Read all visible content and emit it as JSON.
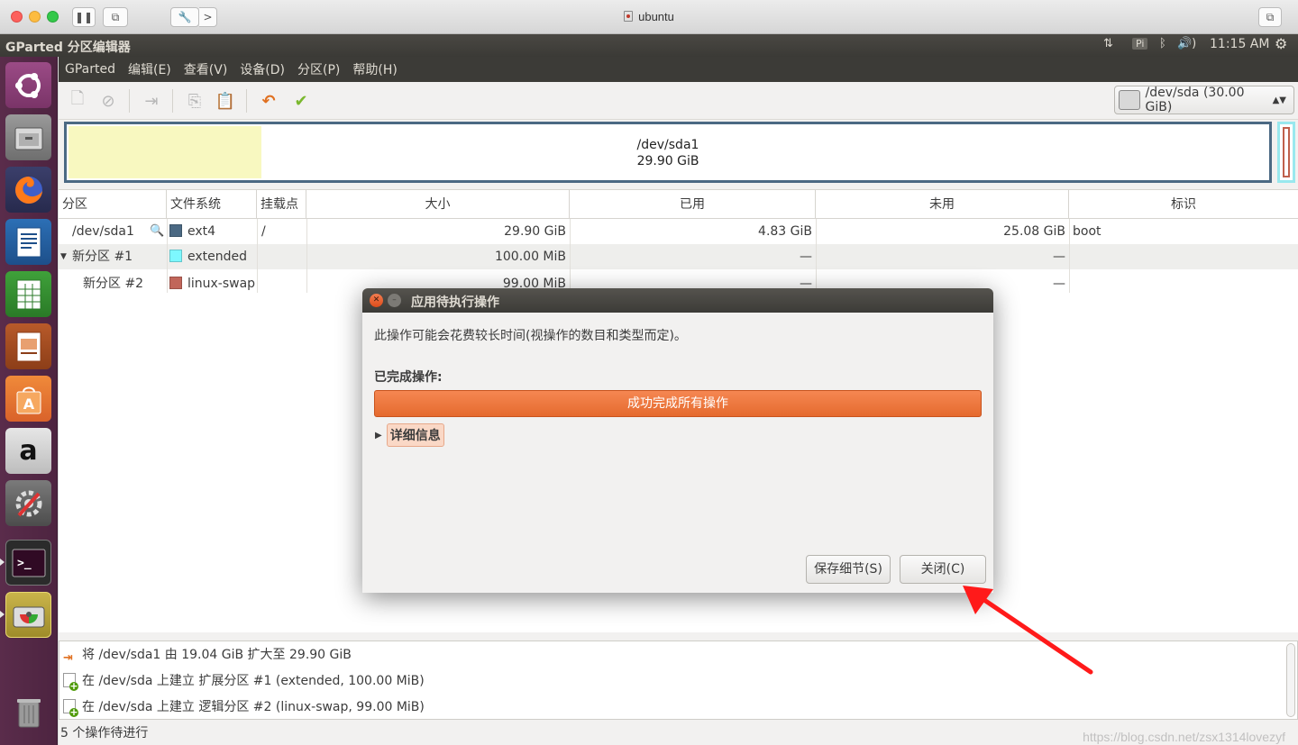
{
  "mac": {
    "title": "ubuntu",
    "tools_label": "🔧",
    "tools_chevron": ">"
  },
  "panel": {
    "app_title": "GParted 分区编辑器",
    "kbd": "Pi",
    "volume": "🔊)",
    "time": "11:15 AM"
  },
  "menubar": {
    "items": [
      "GParted",
      "编辑(E)",
      "查看(V)",
      "设备(D)",
      "分区(P)",
      "帮助(H)"
    ]
  },
  "toolbar": {
    "device": "/dev/sda  (30.00 GiB)"
  },
  "partition_map": {
    "name": "/dev/sda1",
    "size": "29.90 GiB"
  },
  "table": {
    "headers": [
      "分区",
      "文件系统",
      "挂载点",
      "大小",
      "已用",
      "未用",
      "标识"
    ],
    "rows": [
      {
        "partition": "/dev/sda1",
        "fs": "ext4",
        "fs_color": "#4b6983",
        "mount": "/",
        "size": "29.90 GiB",
        "used": "4.83 GiB",
        "unused": "25.08 GiB",
        "flags": "boot"
      },
      {
        "partition": "新分区 #1",
        "fs": "extended",
        "fs_color": "#7df8ff",
        "mount": "",
        "size": "100.00 MiB",
        "used": "—",
        "unused": "—",
        "flags": ""
      },
      {
        "partition": "新分区 #2",
        "fs": "linux-swap",
        "fs_color": "#c1665a",
        "mount": "",
        "size": "99.00 MiB",
        "used": "—",
        "unused": "—",
        "flags": ""
      }
    ]
  },
  "operations": [
    {
      "text": "将 /dev/sda1 由 19.04 GiB 扩大至 29.90 GiB",
      "icon": "resize-icon"
    },
    {
      "text": "在 /dev/sda 上建立 扩展分区 #1 (extended, 100.00 MiB)",
      "icon": "new-partition-icon"
    },
    {
      "text": "在 /dev/sda 上建立 逻辑分区 #2 (linux-swap, 99.00 MiB)",
      "icon": "new-partition-icon"
    }
  ],
  "status": {
    "text": "5 个操作待进行",
    "watermark": "https://blog.csdn.net/zsx1314lovezyf"
  },
  "dialog": {
    "title": "应用待执行操作",
    "message": "此操作可能会花费较长时间(视操作的数目和类型而定)。",
    "done_label": "已完成操作:",
    "progress_text": "成功完成所有操作",
    "progress_fraction": 1.0,
    "details_label": "详细信息",
    "save_button": "保存细节(S)",
    "close_button": "关闭(C)"
  },
  "colors": {
    "accent": "#e95420",
    "launcher": "#5a2c4b",
    "panel": "#3c3b37",
    "arrow": "#ff1a1a"
  }
}
